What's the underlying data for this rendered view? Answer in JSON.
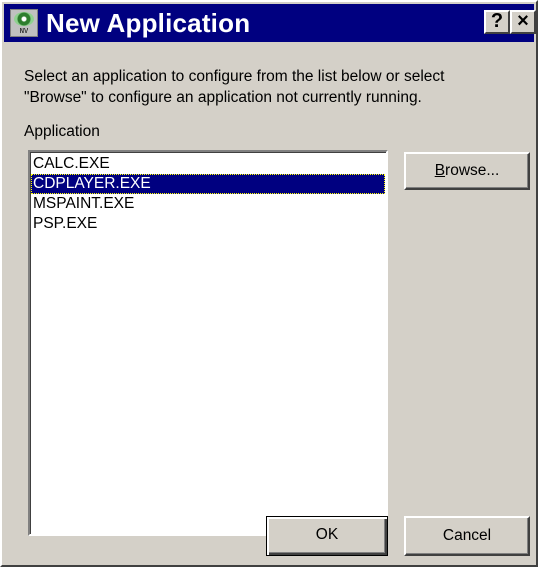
{
  "window": {
    "title": "New Application",
    "icon": "app-disc-icon",
    "icon_text": "NV",
    "help_button": "?",
    "close_button": "×"
  },
  "instructions": "Select an application to configure from the list below or select\n\"Browse\" to configure an application not currently running.",
  "list": {
    "label": "Application",
    "items": [
      "CALC.EXE",
      "CDPLAYER.EXE",
      "MSPAINT.EXE",
      "PSP.EXE"
    ],
    "selected_index": 1
  },
  "buttons": {
    "browse_mnemonic": "B",
    "browse_rest": "rowse...",
    "ok": "OK",
    "cancel": "Cancel"
  },
  "colors": {
    "titlebar": "#000080",
    "face": "#d4d0c8",
    "selection": "#000080"
  }
}
